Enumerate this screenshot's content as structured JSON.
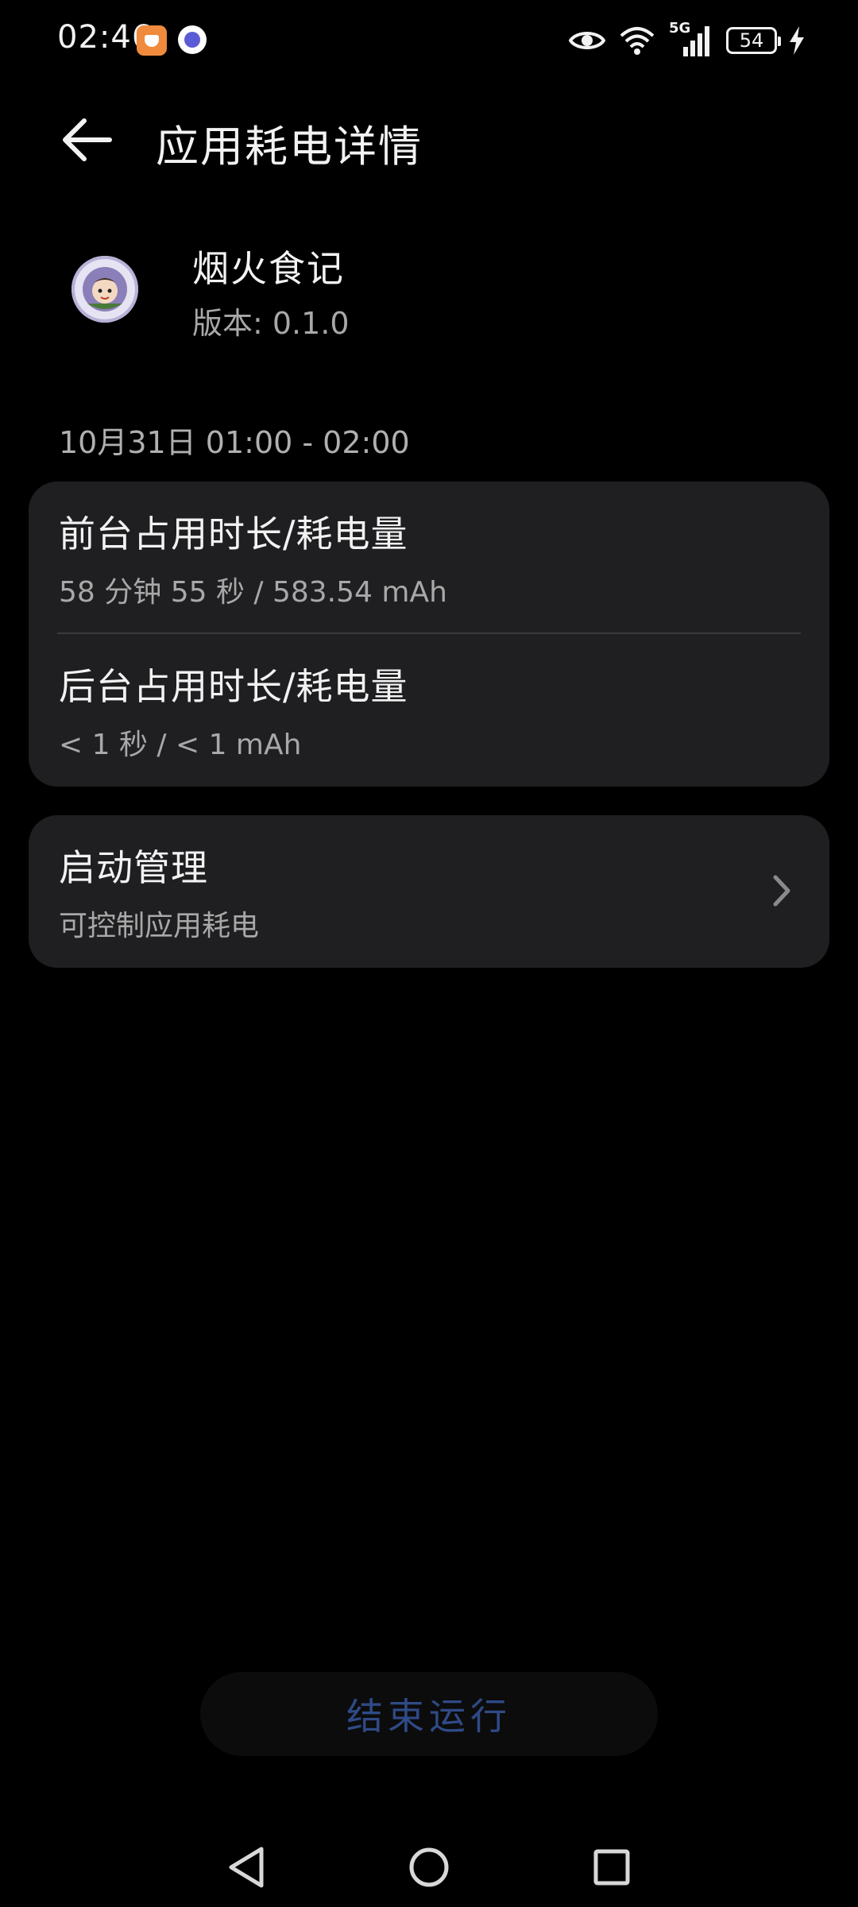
{
  "status_bar": {
    "time": "02:46",
    "network": "5G",
    "battery": "54"
  },
  "header": {
    "title": "应用耗电详情"
  },
  "app": {
    "name": "烟火食记",
    "version": "版本:  0.1.0"
  },
  "date_range": "10月31日 01:00 - 02:00",
  "usage": {
    "foreground_title": "前台占用时长/耗电量",
    "foreground_value": "58 分钟 55 秒 / 583.54 mAh",
    "background_title": "后台占用时长/耗电量",
    "background_value": "< 1 秒 / < 1 mAh"
  },
  "startup": {
    "title": "启动管理",
    "subtitle": "可控制应用耗电"
  },
  "end_button": "结束运行",
  "colors": {
    "background": "#000000",
    "card": "#1f1f21",
    "accent": "#2f4a86"
  }
}
